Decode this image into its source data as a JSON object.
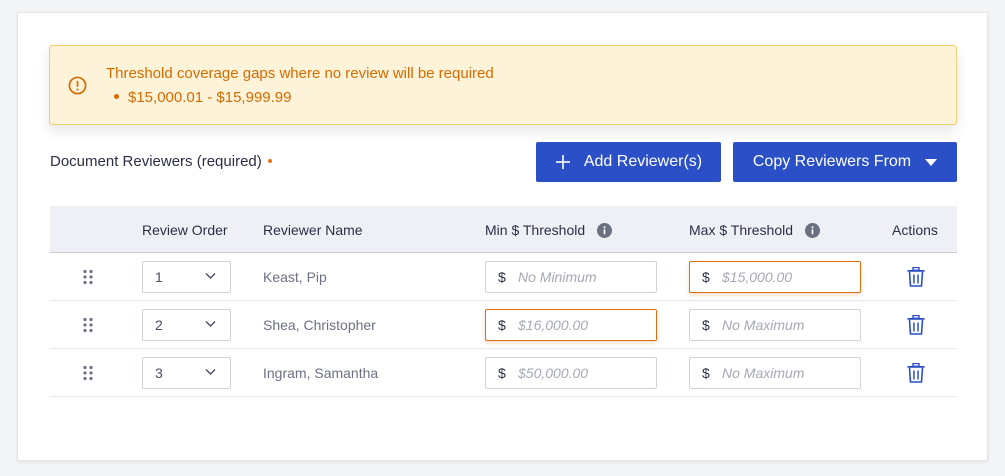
{
  "alert": {
    "title": "Threshold coverage gaps where no review will be required",
    "gaps": [
      "$15,000.01 - $15,999.99"
    ],
    "icon": "warning-circle-icon",
    "color": "#d56b00",
    "background": "#fdf3d8"
  },
  "section": {
    "title": "Document Reviewers (required)",
    "required_marker_color": "#e8731b"
  },
  "buttons": {
    "add_label": "Add Reviewer(s)",
    "copy_label": "Copy Reviewers From",
    "color": "#2a4fc7"
  },
  "table": {
    "headers": {
      "order": "Review Order",
      "name": "Reviewer Name",
      "min": "Min $ Threshold",
      "max": "Max $ Threshold",
      "actions": "Actions"
    },
    "rows": [
      {
        "order": "1",
        "name": "Keast, Pip",
        "currency": "$",
        "min": "No Minimum",
        "max": "$15,000.00",
        "min_error": false,
        "max_error": true
      },
      {
        "order": "2",
        "name": "Shea, Christopher",
        "currency": "$",
        "min": "$16,000.00",
        "max": "No Maximum",
        "min_error": true,
        "max_error": false
      },
      {
        "order": "3",
        "name": "Ingram, Samantha",
        "currency": "$",
        "min": "$50,000.00",
        "max": "No Maximum",
        "min_error": false,
        "max_error": false
      }
    ]
  }
}
